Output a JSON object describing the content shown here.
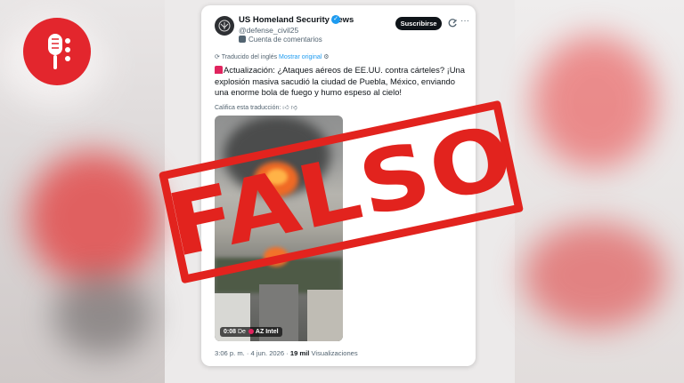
{
  "stamp": {
    "text": "FALSO",
    "color": "#e2231e"
  },
  "brand": {
    "logo_icon": "microphone-icon",
    "color": "#e3262d"
  },
  "post": {
    "account_name": "US Homeland Security News",
    "handle": "@defense_civil25",
    "affiliation": "Cuenta de comentarios",
    "subscribe_label": "Suscribirse",
    "translated_prefix": "Traducido del inglés",
    "show_original_label": "Mostrar original",
    "text": "Actualización: ¿Ataques aéreos de EE.UU. contra cárteles? ¡Una explosión masiva sacudió la ciudad de Puebla, México, enviando una enorme bola de fuego y humo espeso al cielo!",
    "rate_translation": "Califica esta traducción:",
    "video": {
      "duration": "0:08",
      "source_prefix": "De",
      "source": "AZ Intel"
    },
    "timestamp": "3:06 p. m. · 4 jun. 2026 · ",
    "views_count": "19 mil",
    "views_label": " Visualizaciones"
  }
}
